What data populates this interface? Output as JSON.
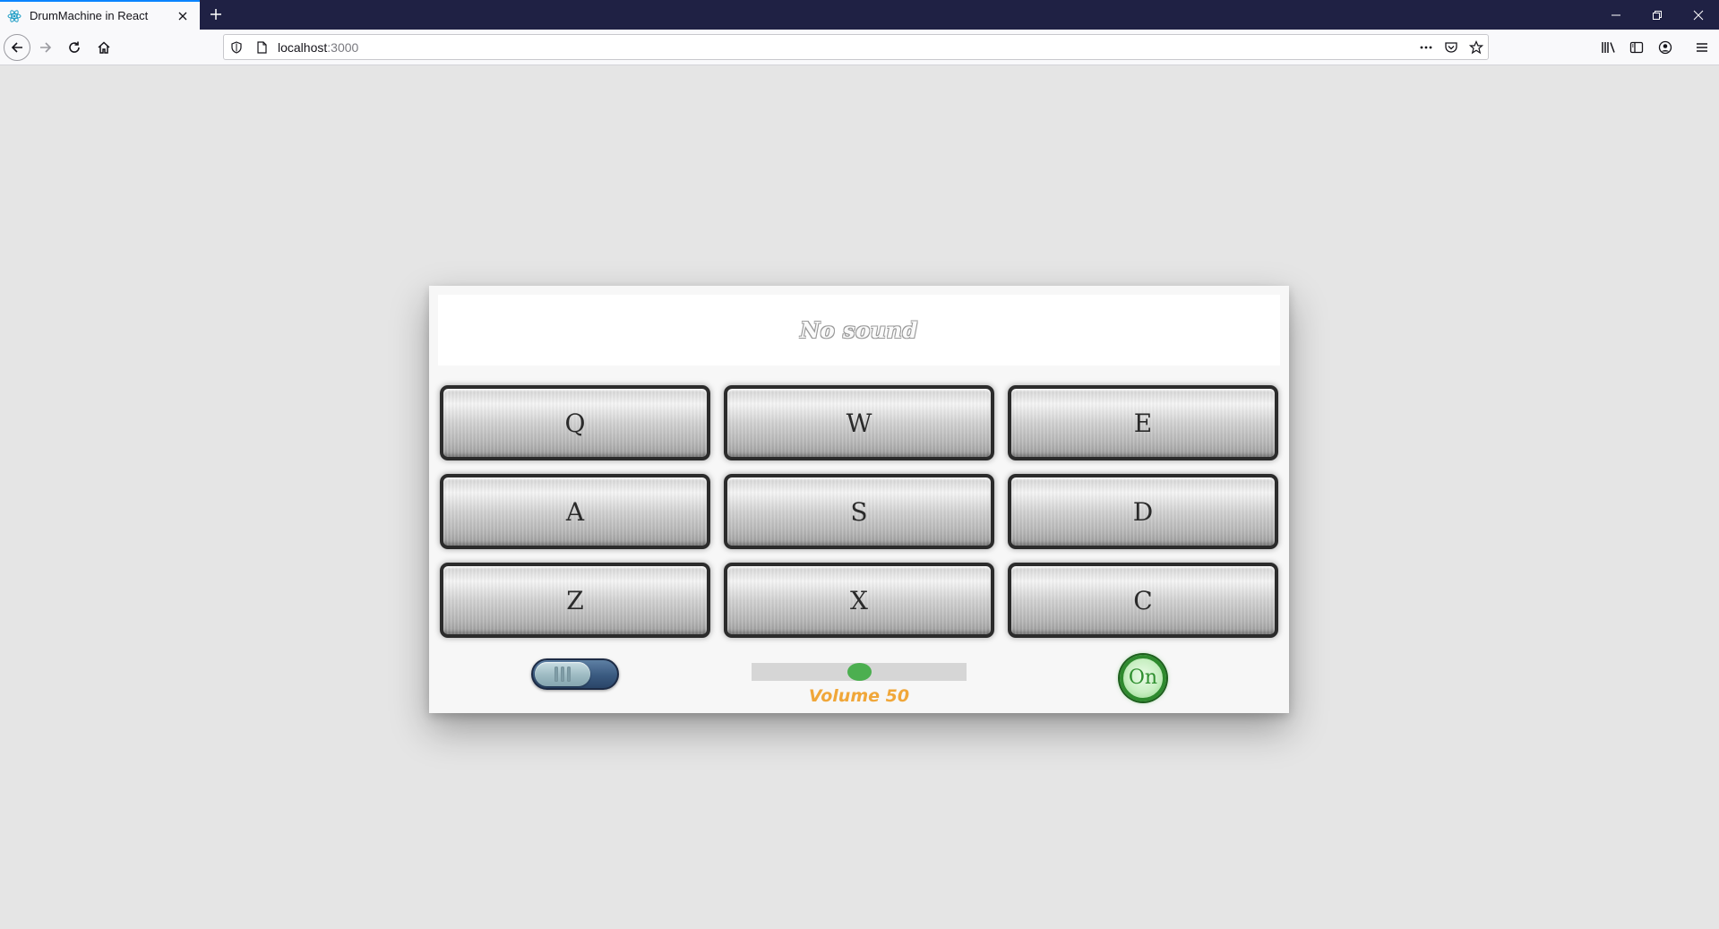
{
  "browser": {
    "tab_title": "DrumMachine in React",
    "url_host": "localhost",
    "url_port": ":3000"
  },
  "drum_machine": {
    "display_text": "No sound",
    "pads": [
      "Q",
      "W",
      "E",
      "A",
      "S",
      "D",
      "Z",
      "X",
      "C"
    ],
    "volume_value": 50,
    "volume_label": "Volume 50",
    "power_label": "On",
    "colors": {
      "volume_thumb": "#4caf50",
      "volume_label": "#f0a73a",
      "power_ring": "#2e8a2e",
      "toggle_track": "#3a5a80",
      "pad_border": "#2b2b2b"
    }
  }
}
